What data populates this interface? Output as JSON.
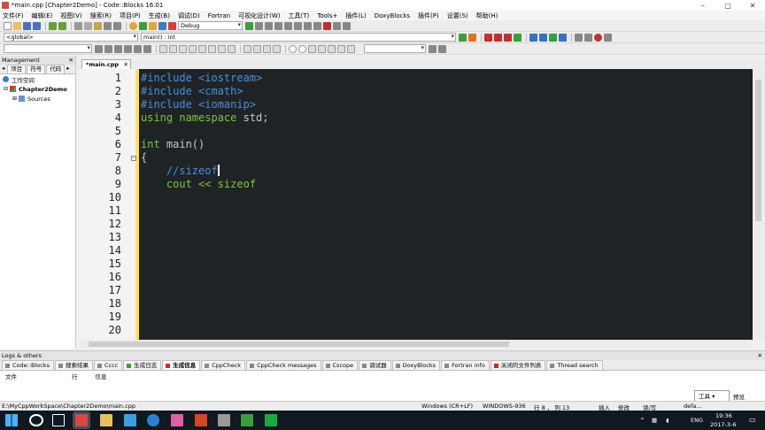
{
  "window": {
    "title": "*main.cpp [Chapter2Demo] - Code::Blocks 16.01",
    "controls": [
      "–",
      "▢",
      "✕"
    ]
  },
  "menu": [
    "文件(F)",
    "编辑(E)",
    "视图(V)",
    "搜索(R)",
    "项目(P)",
    "生成(B)",
    "调试(D)",
    "Fortran",
    "可视化设计(W)",
    "工具(T)",
    "Tools+",
    "插件(L)",
    "DoxyBlocks",
    "插件(P)",
    "设置(S)",
    "帮助(H)"
  ],
  "toolbar": {
    "build_target": "Debug",
    "scope": "<global>",
    "function": "main() : int"
  },
  "management": {
    "title": "Management",
    "tabs": [
      "项目",
      "符号",
      "代码"
    ],
    "tree": {
      "workspace": "工作空间",
      "project": "Chapter2Demo",
      "folder": "Sources"
    }
  },
  "editor": {
    "tab_label": "*main.cpp",
    "line_numbers": [
      "1",
      "2",
      "3",
      "4",
      "5",
      "6",
      "7",
      "8",
      "9",
      "10",
      "11",
      "12",
      "13",
      "14",
      "15",
      "16",
      "17",
      "18",
      "19",
      "20"
    ],
    "code": {
      "l1": "#include <iostream>",
      "l2": "#include <cmath>",
      "l3": "#include <iomanip>",
      "l4_kw": "using namespace",
      "l4_rest": " std;",
      "l6_kw": "int",
      "l6_rest": " main()",
      "l7": "{",
      "l8": "    //sizeof",
      "l9_a": "    cout << ",
      "l9_b": "sizeof"
    }
  },
  "logs": {
    "title": "Logs & others",
    "tabs": [
      "Code::Blocks",
      "搜索结果",
      "Cccc",
      "生成日志",
      "生成信息",
      "CppCheck",
      "CppCheck messages",
      "Cscope",
      "调试器",
      "DoxyBlocks",
      "Fortran info",
      "关闭的文件列表",
      "Thread search"
    ],
    "active_tab": "生成信息",
    "columns": [
      "文件",
      "行",
      "信息"
    ]
  },
  "statusbar": {
    "path": "E:\\MyCppWorkSpace\\Chapter2Demo\\main.cpp",
    "line_ending": "Windows (CR+LF)",
    "encoding": "WINDOWS-936",
    "position": "行 8 ， 列 13",
    "insert": "插入",
    "modified": "修改",
    "rw": "读/写",
    "profile": "defa..."
  },
  "ime": {
    "tool": "工具",
    "preview": "预览"
  },
  "taskbar": {
    "lang": "ENG",
    "time": "19:36",
    "date": "2017-3-6"
  },
  "colors": {
    "editor_bg": "#1f2326",
    "preprocessor": "#4c8edb",
    "keyword": "#7ec436",
    "change_marker": "#ffe060",
    "taskbar": "#101820"
  }
}
